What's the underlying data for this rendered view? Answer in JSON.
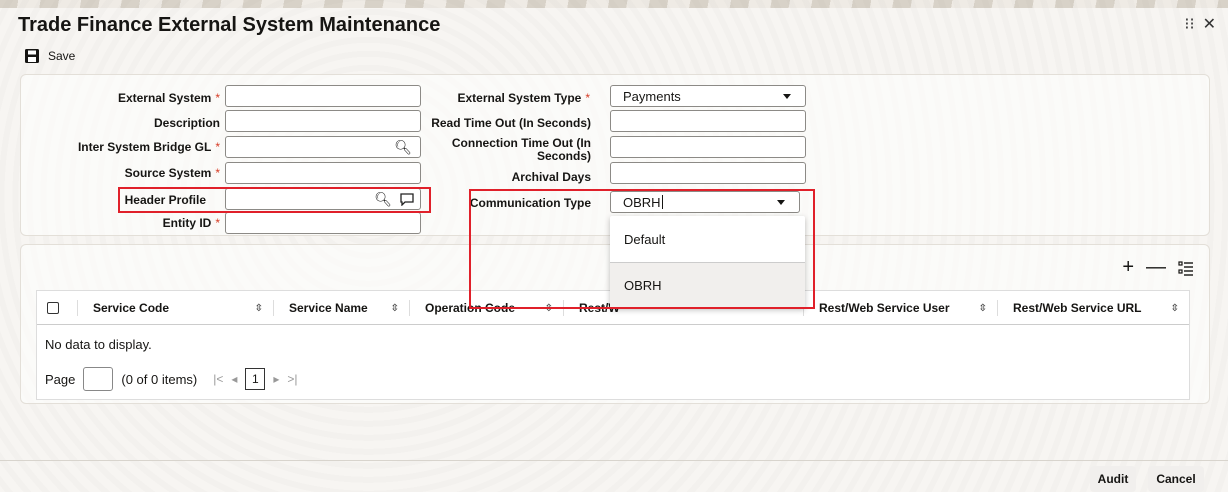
{
  "window": {
    "title": "Trade Finance External System Maintenance"
  },
  "toolbar": {
    "save_label": "Save"
  },
  "form": {
    "external_system_label": "External System",
    "description_label": "Description",
    "inter_system_bridge_gl_label": "Inter System Bridge GL",
    "source_system_label": "Source System",
    "header_profile_label": "Header Profile",
    "entity_id_label": "Entity ID",
    "external_system_type_label": "External System Type",
    "external_system_type_value": "Payments",
    "read_time_out_label": "Read Time Out (In Seconds)",
    "connection_time_out_label_1": "Connection Time Out (In",
    "connection_time_out_label_2": "Seconds)",
    "archival_days_label": "Archival Days",
    "communication_type_label": "Communication Type",
    "communication_type_value": "OBRH",
    "required_marker": "*"
  },
  "dropdown": {
    "options": [
      "Default",
      "OBRH"
    ],
    "selected": "OBRH"
  },
  "grid": {
    "columns": [
      "Service Code",
      "Service Name",
      "Operation Code",
      "Rest/W",
      "Rest/Web Service User",
      "Rest/Web Service URL"
    ],
    "empty_text": "No data to display.",
    "pager": {
      "page_label": "Page",
      "count_text": "(0 of 0 items)",
      "current_page": "1"
    }
  },
  "footer": {
    "audit_label": "Audit",
    "cancel_label": "Cancel"
  },
  "colors": {
    "required": "#d63b25",
    "highlight_box": "#e0202a"
  }
}
